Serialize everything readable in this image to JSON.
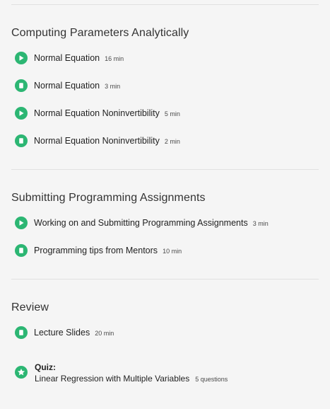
{
  "sections": [
    {
      "title": "Computing Parameters Analytically",
      "items": [
        {
          "type": "video",
          "icon": "play-icon",
          "title": "Normal Equation",
          "duration": "16 min"
        },
        {
          "type": "reading",
          "icon": "reading-icon",
          "title": "Normal Equation",
          "duration": "3 min"
        },
        {
          "type": "video",
          "icon": "play-icon",
          "title": "Normal Equation Noninvertibility",
          "duration": "5 min"
        },
        {
          "type": "reading",
          "icon": "reading-icon",
          "title": "Normal Equation Noninvertibility",
          "duration": "2 min"
        }
      ]
    },
    {
      "title": "Submitting Programming Assignments",
      "items": [
        {
          "type": "video",
          "icon": "play-icon",
          "title": "Working on and Submitting Programming Assignments",
          "duration": "3 min"
        },
        {
          "type": "reading",
          "icon": "reading-icon",
          "title": "Programming tips from Mentors",
          "duration": "10 min"
        }
      ]
    },
    {
      "title": "Review",
      "items": [
        {
          "type": "reading",
          "icon": "reading-icon",
          "title": "Lecture Slides",
          "duration": "20 min"
        }
      ],
      "quiz": {
        "icon": "star-icon",
        "label": "Quiz:",
        "title": "Linear Regression with Multiple Variables",
        "questions": "5 questions"
      }
    }
  ],
  "colors": {
    "accent": "#2cb673",
    "divider": "#e1e1e1",
    "background": "#f5f5f5"
  }
}
